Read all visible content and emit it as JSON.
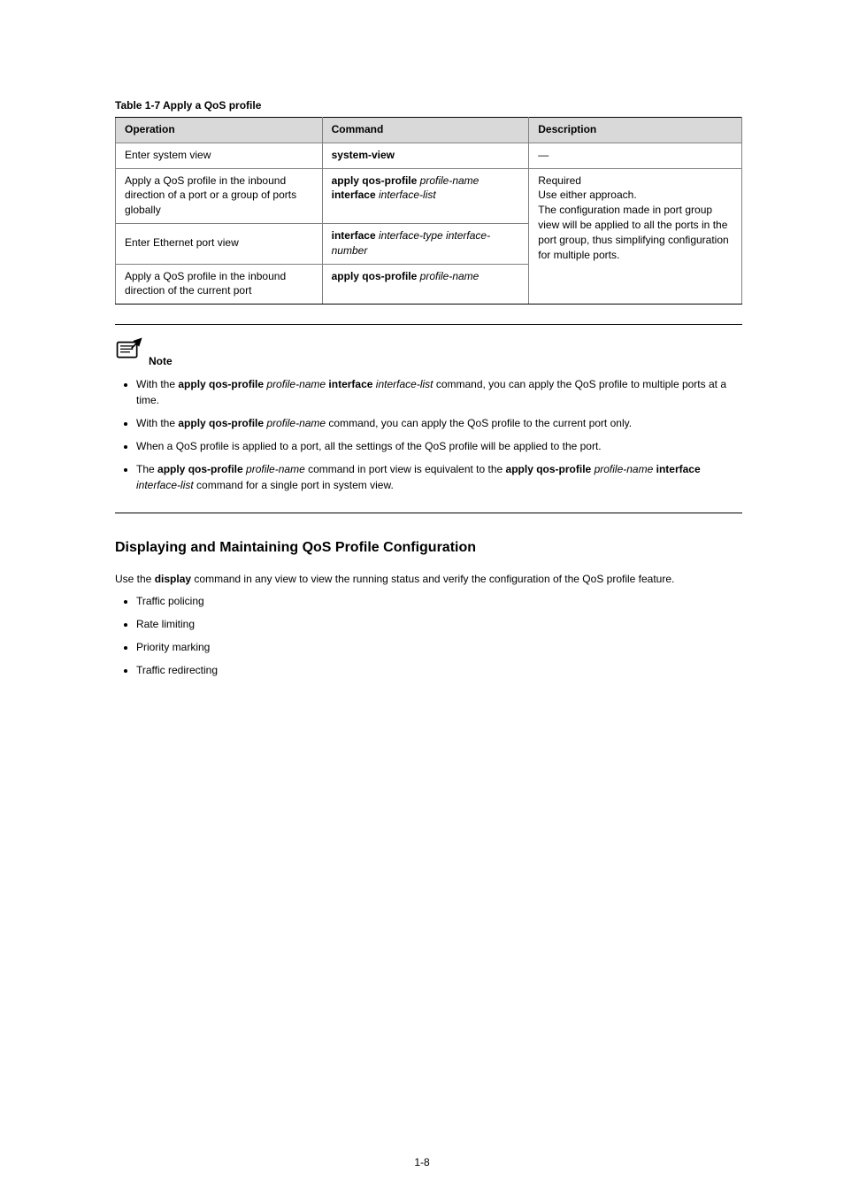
{
  "table": {
    "caption": "Table 1-7 Apply a QoS profile",
    "headers": [
      "Operation",
      "Command",
      "Description"
    ],
    "rows": [
      {
        "op": "Enter system view",
        "cmd": "system-view",
        "desc": "—"
      },
      {
        "op": "Apply a QoS profile in the inbound direction of a port or a group of ports globally",
        "cmd_strong": "apply qos-profile",
        "cmd_rest_parts": [
          " ",
          "profile-name",
          " ",
          {
            "b": "interface"
          },
          " ",
          "interface-list"
        ],
        "desc": "Required\nUse either approach.\nThe configuration made in port group view will be applied to all the ports in the port group, thus simplifying configuration for multiple ports."
      },
      {
        "op": "Enter Ethernet port view",
        "cmd_strong": "interface",
        "cmd_rest_parts": [
          " ",
          "interface-type interface-number"
        ],
        "desc": ""
      },
      {
        "op": "Apply a QoS profile in the inbound direction of the current port",
        "cmd_strong": "apply qos-profile",
        "cmd_rest_parts": [
          " ",
          "profile-name"
        ],
        "desc": ""
      }
    ]
  },
  "note": {
    "label": "Note",
    "items": [
      {
        "pre": "With the ",
        "b1": "apply qos-profile",
        "mid": " ",
        "i1": "profile-name",
        "post": " interface ",
        "b2": "",
        "i2": "interface-list",
        "tail": " command, you can apply the QoS profile to multiple ports at a time.",
        "style": "mix1"
      },
      {
        "pre": "With the ",
        "b1": "apply qos-profile",
        "mid": " ",
        "i1": "profile-name",
        "post": "",
        "tail": " command, you can apply the QoS profile to the current port only.",
        "style": "mix2"
      },
      {
        "text": "When a QoS profile is applied to a port, all the settings of the QoS profile will be applied to the port."
      },
      {
        "pre": "The ",
        "b1": "apply qos-profile",
        "mid": " ",
        "i1": "profile-name",
        "mid2": " command in port view is equivalent to the ",
        "b2": "apply qos-profile",
        "i2": "profile-name",
        "mid3": " ",
        "b3": "interface",
        "tail": " command for a single port in system view.",
        "style": "mix3",
        "i3": "interface-list",
        "sp": " "
      }
    ]
  },
  "maint": {
    "heading": "Displaying and Maintaining QoS Profile Configuration",
    "intro": "Use the ",
    "cmd": "display",
    "intro2": " command in any view to view the running status and verify the configuration of the QoS profile feature.",
    "items": [
      "Traffic policing",
      "Rate limiting",
      "Priority marking",
      "Traffic redirecting"
    ]
  },
  "page": "1-8"
}
